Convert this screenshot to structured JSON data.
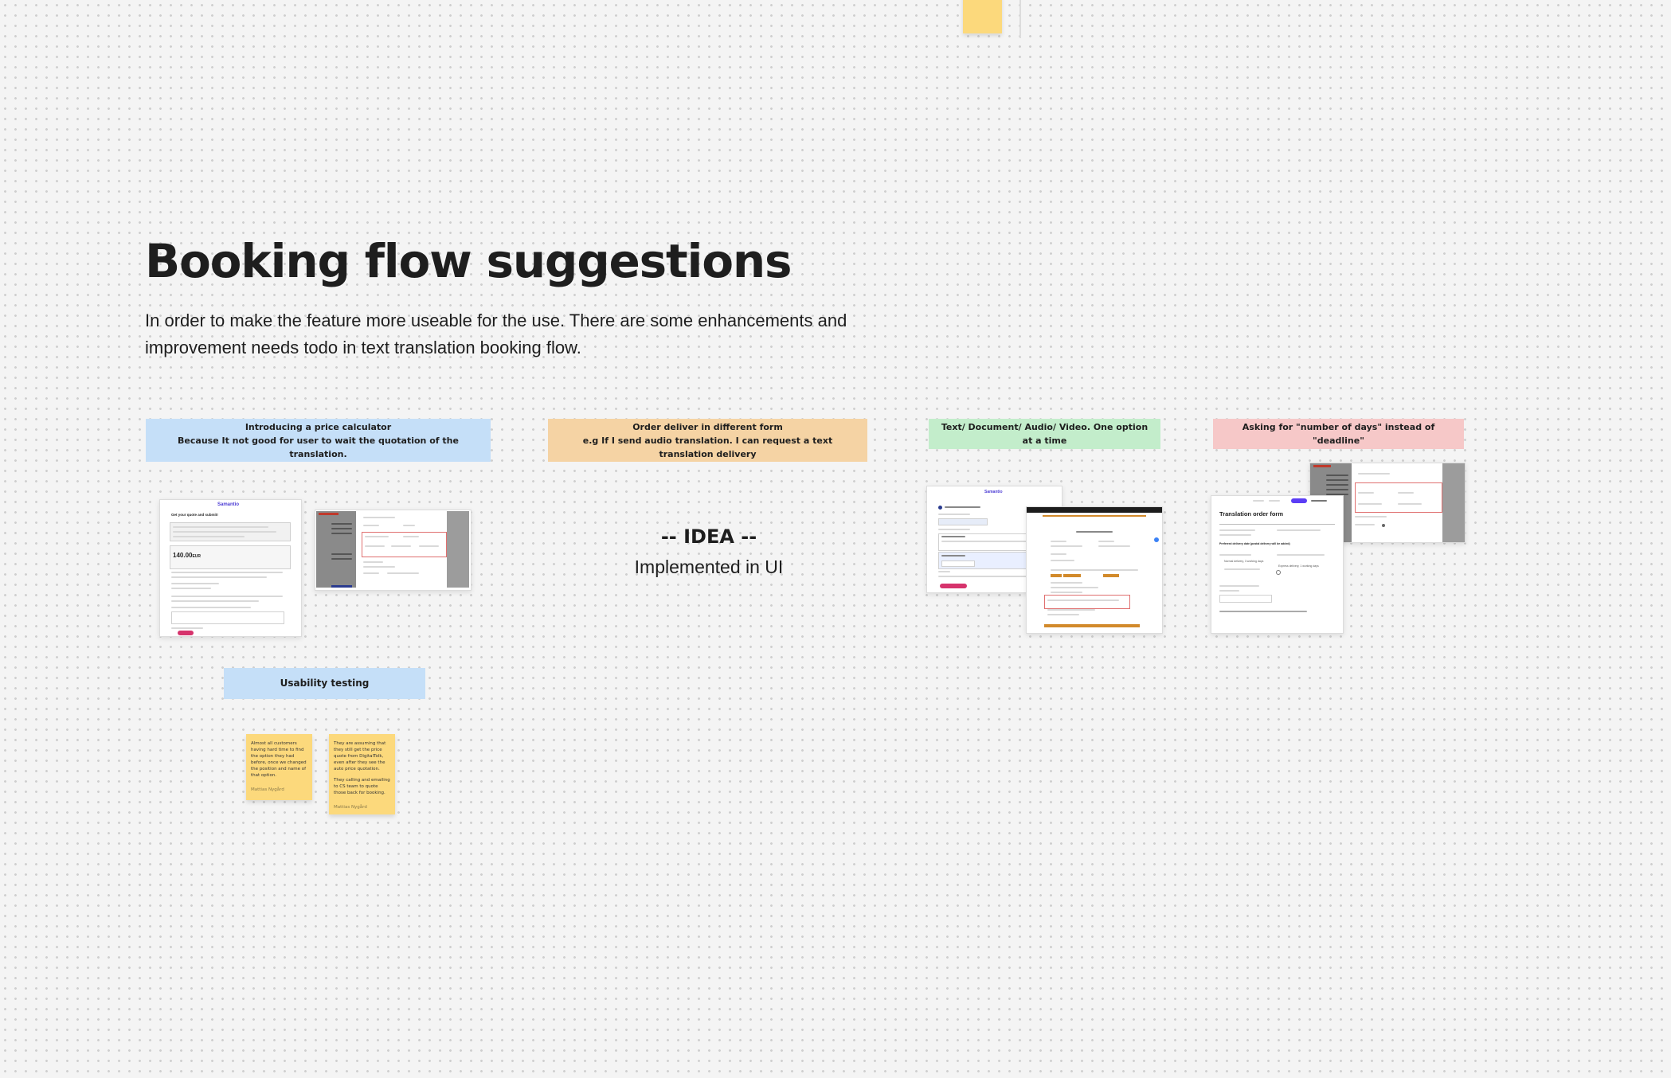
{
  "heading": {
    "title": "Booking flow suggestions",
    "description": "In order to make the feature more useable for the use. There are some enhancements and improvement needs todo in text translation booking flow."
  },
  "sections": [
    {
      "line1": "Introducing a price calculator",
      "line2": "Because It not good for user to wait the quotation of the translation.",
      "color": "#c5dff8"
    },
    {
      "line1": "Order deliver in different form",
      "line2": "e.g If I send audio translation. I can request a text translation delivery",
      "color": "#f5d3a4"
    },
    {
      "line1": "Text/ Document/ Audio/ Video. One option at a time",
      "line2": "",
      "color": "#c3edcb"
    },
    {
      "line1": "Asking for \"number of days\" instead of \"deadline\"",
      "line2": "",
      "color": "#f6c8c8"
    }
  ],
  "idea": {
    "title": "-- IDEA --",
    "subtitle": "Implemented in UI"
  },
  "usability": {
    "label": "Usability testing",
    "notes": [
      {
        "text": "Almost all customers having hard time to find the option they had before, once we changed the position and name of that option.",
        "author": "Mattias Nygård"
      },
      {
        "text": "They are assuming that they still get the price quote from DigitalTolk, even after they see the auto price quotation.",
        "text2": "They calling and emailing to CS team to quote those back for booking.",
        "author": "Mattias Nygård"
      }
    ]
  },
  "mock_text": {
    "brand": "Samantio",
    "get_quote": "Get your quote and submit!",
    "price": "140.00",
    "currency": "EUR",
    "form_title": "Translation order form",
    "delivery_label": "Preferred delivery date (postal delivery will be added)",
    "normal": "Normal delivery, 3 working days",
    "express": "Express delivery, 1 working days"
  },
  "colors": {
    "canvas": "#f4f4f4",
    "sticky": "#fcd97c",
    "accent_pink": "#d6336c"
  }
}
